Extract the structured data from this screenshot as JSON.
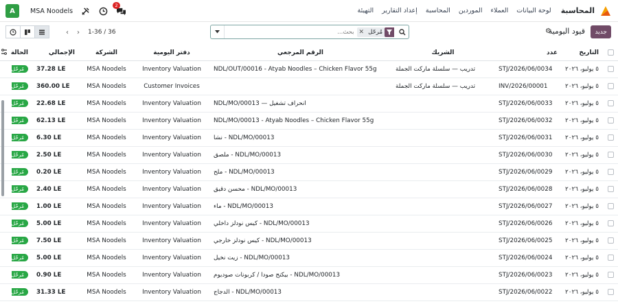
{
  "navbar": {
    "app_name": "المحاسبة",
    "menu": [
      "لوحة البيانات",
      "العملاء",
      "الموردين",
      "المحاسبة",
      "إعداد التقارير",
      "التهيئة"
    ],
    "company": "MSA Noodels",
    "avatar_letter": "A",
    "chat_badge": "2"
  },
  "control": {
    "new_button": "جديد",
    "title": "قيود اليومية",
    "search_placeholder": "بحث...",
    "facet_label": "مُرحّل",
    "pager_value": "1-36 / 36"
  },
  "table": {
    "headers": {
      "date": "التاريخ",
      "number": "عدد",
      "partner": "الشريك",
      "reference": "الرقم المرجعي",
      "journal": "دفتر اليومية",
      "company": "الشركة",
      "total": "الإجمالي",
      "state": "الحالة"
    },
    "rows": [
      {
        "date": "٥ يوليو، ٢٠٢٦",
        "number": "STJ/2026/06/0034",
        "partner": "تدريب — سلسلة ماركت الجملة",
        "reference": "NDL/OUT/00016 - Atyab Noodles – Chicken Flavor 55g",
        "journal": "Inventory Valuation",
        "company": "MSA Noodels",
        "total": "37.28 LE",
        "state": "مُرحّل"
      },
      {
        "date": "٥ يوليو، ٢٠٢٦",
        "number": "INV/2026/00001",
        "partner": "تدريب — سلسلة ماركت الجملة",
        "reference": "",
        "journal": "Customer Invoices",
        "company": "MSA Noodels",
        "total": "360.00 LE",
        "state": "مُرحّل"
      },
      {
        "date": "٥ يوليو، ٢٠٢٦",
        "number": "STJ/2026/06/0033",
        "partner": "",
        "reference": "انحراف تشغيل — NDL/MO/00013",
        "journal": "Inventory Valuation",
        "company": "MSA Noodels",
        "total": "22.68 LE",
        "state": "مُرحّل"
      },
      {
        "date": "٥ يوليو، ٢٠٢٦",
        "number": "STJ/2026/06/0032",
        "partner": "",
        "reference": "NDL/MO/00013 - Atyab Noodles – Chicken Flavor 55g",
        "journal": "Inventory Valuation",
        "company": "MSA Noodels",
        "total": "62.13 LE",
        "state": "مُرحّل"
      },
      {
        "date": "٥ يوليو، ٢٠٢٦",
        "number": "STJ/2026/06/0031",
        "partner": "",
        "reference": "NDL/MO/00013 - نشا",
        "journal": "Inventory Valuation",
        "company": "MSA Noodels",
        "total": "6.30 LE",
        "state": "مُرحّل"
      },
      {
        "date": "٥ يوليو، ٢٠٢٦",
        "number": "STJ/2026/06/0030",
        "partner": "",
        "reference": "NDL/MO/00013 - ملصق",
        "journal": "Inventory Valuation",
        "company": "MSA Noodels",
        "total": "2.50 LE",
        "state": "مُرحّل"
      },
      {
        "date": "٥ يوليو، ٢٠٢٦",
        "number": "STJ/2026/06/0029",
        "partner": "",
        "reference": "NDL/MO/00013 - ملح",
        "journal": "Inventory Valuation",
        "company": "MSA Noodels",
        "total": "0.20 LE",
        "state": "مُرحّل"
      },
      {
        "date": "٥ يوليو، ٢٠٢٦",
        "number": "STJ/2026/06/0028",
        "partner": "",
        "reference": "NDL/MO/00013 - محسن دقيق",
        "journal": "Inventory Valuation",
        "company": "MSA Noodels",
        "total": "2.40 LE",
        "state": "مُرحّل"
      },
      {
        "date": "٥ يوليو، ٢٠٢٦",
        "number": "STJ/2026/06/0027",
        "partner": "",
        "reference": "NDL/MO/00013 - ماء",
        "journal": "Inventory Valuation",
        "company": "MSA Noodels",
        "total": "1.00 LE",
        "state": "مُرحّل"
      },
      {
        "date": "٥ يوليو، ٢٠٢٦",
        "number": "STJ/2026/06/0026",
        "partner": "",
        "reference": "NDL/MO/00013 - كيس نودلز داخلي",
        "journal": "Inventory Valuation",
        "company": "MSA Noodels",
        "total": "5.00 LE",
        "state": "مُرحّل"
      },
      {
        "date": "٥ يوليو، ٢٠٢٦",
        "number": "STJ/2026/06/0025",
        "partner": "",
        "reference": "NDL/MO/00013 - كيس نودلز خارجي",
        "journal": "Inventory Valuation",
        "company": "MSA Noodels",
        "total": "7.50 LE",
        "state": "مُرحّل"
      },
      {
        "date": "٥ يوليو، ٢٠٢٦",
        "number": "STJ/2026/06/0024",
        "partner": "",
        "reference": "NDL/MO/00013 - زيت نخيل",
        "journal": "Inventory Valuation",
        "company": "MSA Noodels",
        "total": "5.00 LE",
        "state": "مُرحّل"
      },
      {
        "date": "٥ يوليو، ٢٠٢٦",
        "number": "STJ/2026/06/0023",
        "partner": "",
        "reference": "NDL/MO/00013 - بيكنج صودا / كربونات صوديوم",
        "journal": "Inventory Valuation",
        "company": "MSA Noodels",
        "total": "0.90 LE",
        "state": "مُرحّل"
      },
      {
        "date": "٥ يوليو، ٢٠٢٦",
        "number": "STJ/2026/06/0022",
        "partner": "",
        "reference": "NDL/MO/00013 - الدجاج",
        "journal": "Inventory Valuation",
        "company": "MSA Noodels",
        "total": "31.33 LE",
        "state": "مُرحّل"
      }
    ]
  },
  "colors": {
    "brand": "#714b67",
    "posted_badge": "#28a745",
    "avatar": "#2f9e44",
    "notification": "#dc2626"
  },
  "icons": {
    "app": "accounting-app-icon",
    "settings": "gear-icon",
    "search": "search-icon",
    "filter": "filter-icon",
    "close": "close-icon",
    "dropdown": "caret-down-icon",
    "pager_prev": "chevron-left-icon",
    "pager_next": "chevron-right-icon",
    "list_view": "list-view-icon",
    "kanban_view": "kanban-view-icon",
    "activity_view": "clock-icon",
    "tools": "tools-icon",
    "chat": "chat-icon",
    "optional_columns": "column-settings-icon"
  }
}
